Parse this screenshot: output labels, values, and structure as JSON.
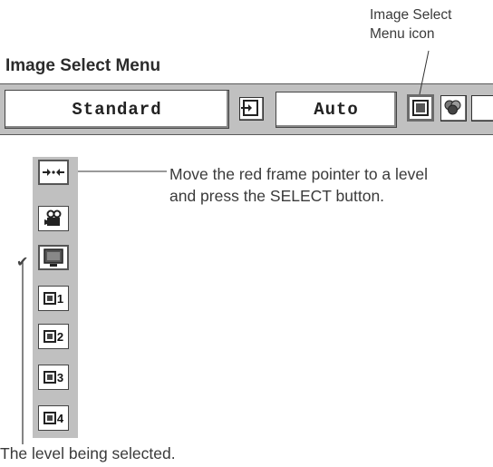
{
  "callouts": {
    "image_select_icon_line1": "Image Select",
    "image_select_icon_line2": "Menu icon",
    "pointer_line1": "Move the red frame pointer to a level",
    "pointer_line2": "and press the SELECT button.",
    "level_selected": "The level being selected."
  },
  "menu": {
    "title": "Image Select Menu",
    "mode_value": "Standard",
    "source_value": "Auto"
  },
  "toolbar_icons": [
    "input-icon",
    "image-select-icon",
    "color-adjust-icon",
    "next-icon"
  ],
  "levels": [
    {
      "icon": "fit-width-icon",
      "label": ""
    },
    {
      "icon": "cinema-camera-icon",
      "label": ""
    },
    {
      "icon": "monitor-icon",
      "label": ""
    },
    {
      "icon": "image-preset-icon",
      "label": "1"
    },
    {
      "icon": "image-preset-icon",
      "label": "2"
    },
    {
      "icon": "image-preset-icon",
      "label": "3"
    },
    {
      "icon": "image-preset-icon",
      "label": "4"
    }
  ],
  "colors": {
    "menubar": "#c0c0c0",
    "frame": "#6b6b6b"
  }
}
